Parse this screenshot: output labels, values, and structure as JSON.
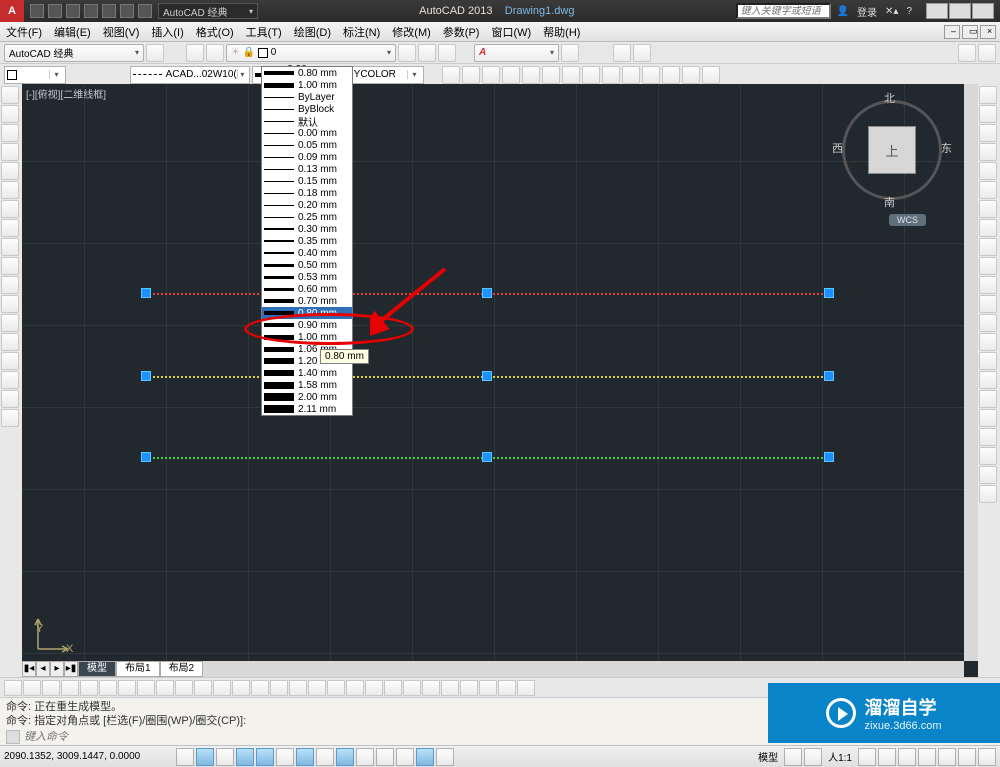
{
  "title": {
    "workspace_label": "AutoCAD 经典",
    "app": "AutoCAD 2013",
    "doc": "Drawing1.dwg",
    "search_placeholder": "键入关键字或短语",
    "login": "登录"
  },
  "menu": [
    "文件(F)",
    "编辑(E)",
    "视图(V)",
    "插入(I)",
    "格式(O)",
    "工具(T)",
    "绘图(D)",
    "标注(N)",
    "修改(M)",
    "参数(P)",
    "窗口(W)",
    "帮助(H)"
  ],
  "workspace_combo": "AutoCAD 经典",
  "layer_combo": "0",
  "prop": {
    "color": "",
    "linetype": "ACAD...02W10(",
    "lineweight": "0.80 mm",
    "plotstyle": "BYCOLOR"
  },
  "lwt_options": [
    {
      "label": "0.80 mm",
      "h": "h4"
    },
    {
      "label": "1.00 mm",
      "h": "h5"
    },
    {
      "label": "ByLayer",
      "h": "h1"
    },
    {
      "label": "ByBlock",
      "h": "h1"
    },
    {
      "label": "默认",
      "h": "h1"
    },
    {
      "label": "0.00 mm",
      "h": "h1"
    },
    {
      "label": "0.05 mm",
      "h": "h1"
    },
    {
      "label": "0.09 mm",
      "h": "h1"
    },
    {
      "label": "0.13 mm",
      "h": "h1"
    },
    {
      "label": "0.15 mm",
      "h": "h1"
    },
    {
      "label": "0.18 mm",
      "h": "h1"
    },
    {
      "label": "0.20 mm",
      "h": "h1"
    },
    {
      "label": "0.25 mm",
      "h": "h1"
    },
    {
      "label": "0.30 mm",
      "h": ""
    },
    {
      "label": "0.35 mm",
      "h": ""
    },
    {
      "label": "0.40 mm",
      "h": ""
    },
    {
      "label": "0.50 mm",
      "h": "h3"
    },
    {
      "label": "0.53 mm",
      "h": "h3"
    },
    {
      "label": "0.60 mm",
      "h": "h3"
    },
    {
      "label": "0.70 mm",
      "h": "h4"
    },
    {
      "label": "0.80 mm",
      "h": "h4",
      "selected": true
    },
    {
      "label": "0.90 mm",
      "h": "h4"
    },
    {
      "label": "1.00 mm",
      "h": "h5"
    },
    {
      "label": "1.06 mm",
      "h": "h5"
    },
    {
      "label": "1.20 mm",
      "h": "h6"
    },
    {
      "label": "1.40 mm",
      "h": "h6"
    },
    {
      "label": "1.58 mm",
      "h": "h7"
    },
    {
      "label": "2.00 mm",
      "h": "h8"
    },
    {
      "label": "2.11 mm",
      "h": "h8"
    }
  ],
  "tooltip": "0.80 mm",
  "viewport_label": "[-][俯视][二维线框]",
  "compass": {
    "n": "北",
    "s": "南",
    "e": "东",
    "w": "西",
    "top": "上",
    "wcs": "WCS"
  },
  "ucs": {
    "x": "X",
    "y": "Y"
  },
  "layout_tabs": [
    "模型",
    "布局1",
    "布局2"
  ],
  "cmd": {
    "line1": "命令:  正在重生成模型。",
    "line2": "命令: 指定对角点或 [栏选(F)/圈围(WP)/圈交(CP)]:",
    "placeholder": "键入命令",
    "prompt_icon": "▷"
  },
  "status": {
    "coords": "2090.1352, 3009.1447, 0.0000",
    "right": {
      "model": "模型",
      "scale": "人1:1",
      "ann": "▲"
    }
  },
  "watermark": {
    "line1": "溜溜自学",
    "line2": "zixue.3d66.com"
  }
}
